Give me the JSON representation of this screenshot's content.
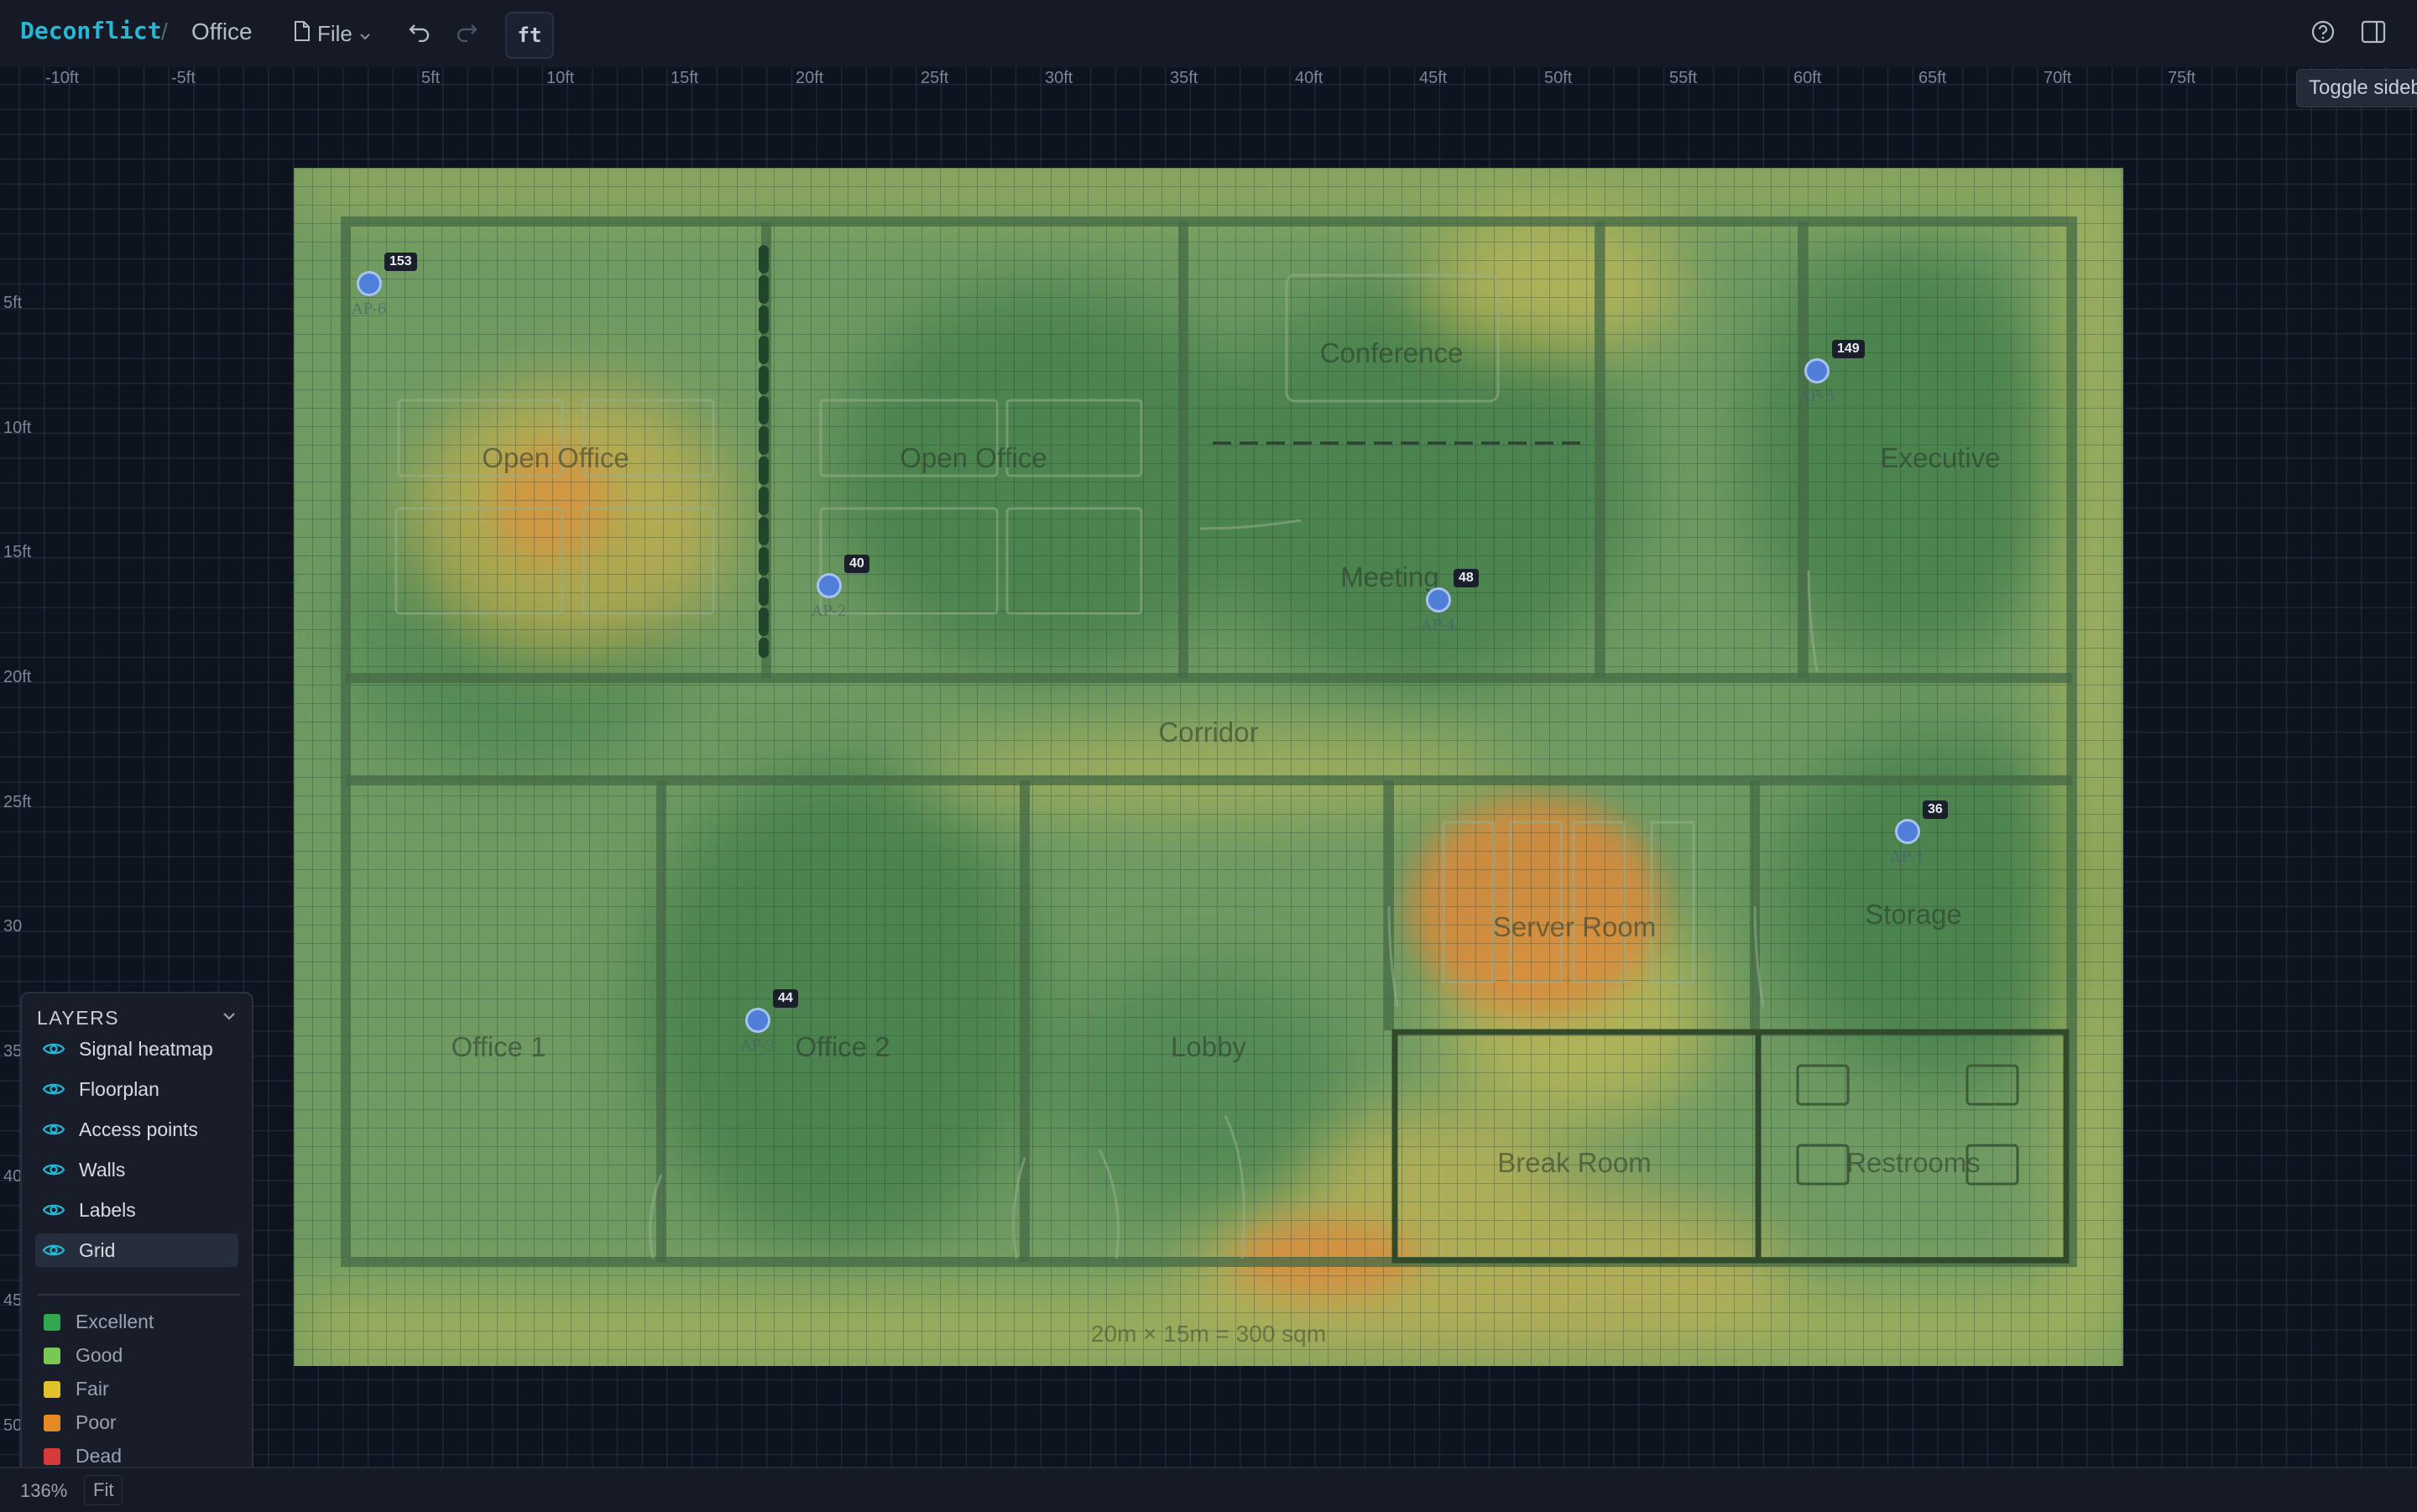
{
  "app": {
    "brand": "Deconflict",
    "breadcrumb_sep": "/",
    "project": "Office",
    "file_menu_label": "File",
    "unit_toggle_label": "ft",
    "sidebar_tooltip": "Toggle sideb"
  },
  "rulers": {
    "x_labels": [
      "-10ft",
      "-5ft",
      "5ft",
      "10ft",
      "15ft",
      "20ft",
      "25ft",
      "30ft",
      "35ft",
      "40ft",
      "45ft",
      "50ft",
      "55ft",
      "60ft",
      "65ft",
      "70ft",
      "75ft"
    ],
    "y_labels": [
      "5ft",
      "10ft",
      "15ft",
      "20ft",
      "25ft",
      "30",
      "35",
      "40",
      "45",
      "50ft"
    ]
  },
  "floorplan": {
    "rooms": [
      "Open Office",
      "Open Office",
      "Conference",
      "Meeting",
      "Executive",
      "Corridor",
      "Server Room",
      "Storage",
      "Office 1",
      "Office 2",
      "Lobby",
      "Break Room",
      "Restrooms"
    ],
    "area_label": "20m × 15m = 300 sqm"
  },
  "access_points": [
    {
      "name": "AP-6",
      "badge": "153"
    },
    {
      "name": "AP-5",
      "badge": "149"
    },
    {
      "name": "AP-2",
      "badge": "40"
    },
    {
      "name": "AP-4",
      "badge": "48"
    },
    {
      "name": "AP-1",
      "badge": "36"
    },
    {
      "name": "AP-3",
      "badge": "44"
    }
  ],
  "layers_panel": {
    "title": "LAYERS",
    "layers": [
      {
        "label": "Signal heatmap",
        "visible": true
      },
      {
        "label": "Floorplan",
        "visible": true
      },
      {
        "label": "Access points",
        "visible": true
      },
      {
        "label": "Walls",
        "visible": true
      },
      {
        "label": "Labels",
        "visible": true
      },
      {
        "label": "Grid",
        "visible": true,
        "active": true
      }
    ],
    "legend": [
      {
        "label": "Excellent",
        "color": "#2fa84f"
      },
      {
        "label": "Good",
        "color": "#7cc653"
      },
      {
        "label": "Fair",
        "color": "#e2c22a"
      },
      {
        "label": "Poor",
        "color": "#e58a22"
      },
      {
        "label": "Dead",
        "color": "#d63a3a"
      }
    ]
  },
  "status": {
    "zoom": "136%",
    "fit_label": "Fit"
  },
  "colors": {
    "accent": "#22b8d6",
    "ap_fill": "#4f7fd8",
    "heat_base": "#6f9a62"
  }
}
